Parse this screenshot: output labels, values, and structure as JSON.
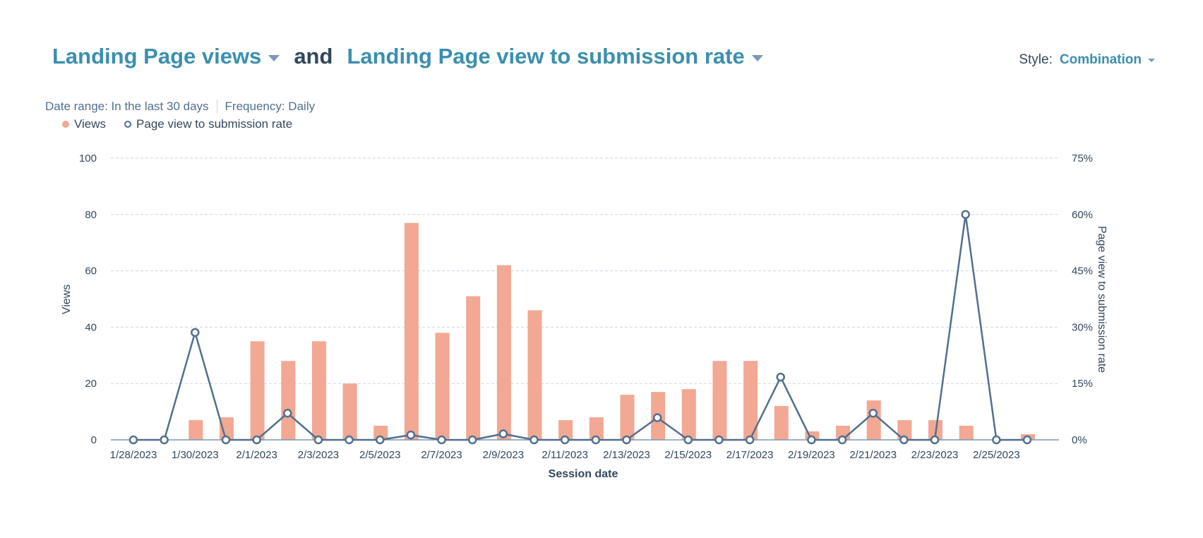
{
  "header": {
    "metric1": "Landing Page views",
    "connector": "and",
    "metric2": "Landing Page view to submission rate"
  },
  "style": {
    "label": "Style:",
    "value": "Combination"
  },
  "filters": {
    "date_range": "Date range: In the last 30 days",
    "frequency": "Frequency: Daily"
  },
  "legend": [
    {
      "label": "Views",
      "marker": "filled-circle",
      "color": "#f2a892"
    },
    {
      "label": "Page view to submission rate",
      "marker": "ring",
      "color": "#516f90"
    }
  ],
  "colors": {
    "accent": "#3b8fae",
    "bar": "#f2a892",
    "line": "#516f90",
    "grid": "#cbd6e2",
    "text": "#33475b"
  },
  "chart_data": {
    "type": "combination",
    "xlabel": "Session date",
    "ylabel_left": "Views",
    "ylabel_right": "Page view to submission rate",
    "ylim_left": [
      0,
      100
    ],
    "ylim_right": [
      0,
      75
    ],
    "yticks_left": [
      "0",
      "20",
      "40",
      "60",
      "80",
      "100"
    ],
    "yticks_right": [
      "0%",
      "15%",
      "30%",
      "45%",
      "60%",
      "75%"
    ],
    "grid": true,
    "legend_position": "top-left",
    "categories": [
      "1/28/2023",
      "1/29/2023",
      "1/30/2023",
      "1/31/2023",
      "2/1/2023",
      "2/2/2023",
      "2/3/2023",
      "2/4/2023",
      "2/5/2023",
      "2/6/2023",
      "2/7/2023",
      "2/8/2023",
      "2/9/2023",
      "2/10/2023",
      "2/11/2023",
      "2/12/2023",
      "2/13/2023",
      "2/14/2023",
      "2/15/2023",
      "2/16/2023",
      "2/17/2023",
      "2/18/2023",
      "2/19/2023",
      "2/20/2023",
      "2/21/2023",
      "2/22/2023",
      "2/23/2023",
      "2/24/2023",
      "2/25/2023",
      "2/26/2023"
    ],
    "xtick_labels": [
      "1/28/2023",
      "1/30/2023",
      "2/1/2023",
      "2/3/2023",
      "2/5/2023",
      "2/7/2023",
      "2/9/2023",
      "2/11/2023",
      "2/13/2023",
      "2/15/2023",
      "2/17/2023",
      "2/19/2023",
      "2/21/2023",
      "2/23/2023",
      "2/25/2023"
    ],
    "series": [
      {
        "name": "Views",
        "type": "bar",
        "axis": "left",
        "values": [
          0,
          0,
          7,
          8,
          35,
          28,
          35,
          20,
          5,
          77,
          38,
          51,
          62,
          46,
          7,
          8,
          16,
          17,
          18,
          28,
          28,
          12,
          3,
          5,
          14,
          7,
          7,
          5,
          0,
          2
        ]
      },
      {
        "name": "Page view to submission rate",
        "type": "line",
        "axis": "right",
        "unit": "%",
        "values": [
          0,
          0,
          28.6,
          0,
          0,
          7.1,
          0,
          0,
          0,
          1.3,
          0,
          0,
          1.6,
          0,
          0,
          0,
          0,
          5.9,
          0,
          0,
          0,
          16.7,
          0,
          0,
          7.1,
          0,
          0,
          60,
          0,
          0
        ]
      }
    ]
  }
}
